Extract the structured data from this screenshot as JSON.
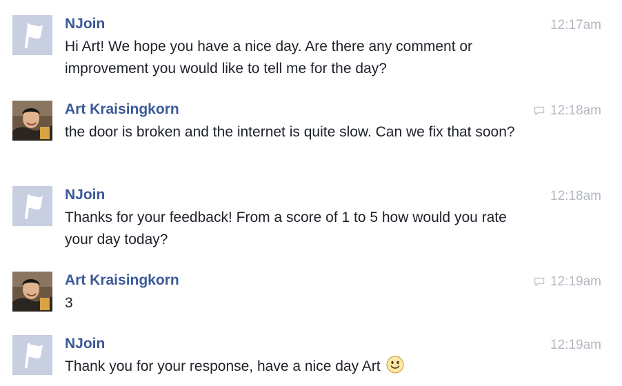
{
  "messages": [
    {
      "sender": "NJoin",
      "text": "Hi Art! We hope you have a nice day. Are there any comment or improvement you would like to tell me for the day?",
      "time": "12:17am",
      "avatar": "page-flag-icon",
      "seen_icon": false
    },
    {
      "sender": "Art Kraisingkorn",
      "text": "the door is broken and the internet is quite slow. Can we fix that soon?",
      "time": "12:18am",
      "avatar": "user-photo",
      "seen_icon": true
    },
    {
      "sender": "NJoin",
      "text": "Thanks for your feedback! From a score of 1 to 5 how would you rate your day today?",
      "time": "12:18am",
      "avatar": "page-flag-icon",
      "seen_icon": false
    },
    {
      "sender": "Art Kraisingkorn",
      "text": "3",
      "time": "12:19am",
      "avatar": "user-photo",
      "seen_icon": true
    },
    {
      "sender": "NJoin",
      "text": "Thank you for your response, have a nice day Art",
      "time": "12:19am",
      "avatar": "page-flag-icon",
      "seen_icon": false,
      "emoji": "smiley-icon"
    }
  ],
  "colors": {
    "sender_name": "#3b5998",
    "message_text": "#1d2129",
    "timestamp": "#b4b8c2",
    "page_avatar_bg": "#c7cfe1"
  }
}
